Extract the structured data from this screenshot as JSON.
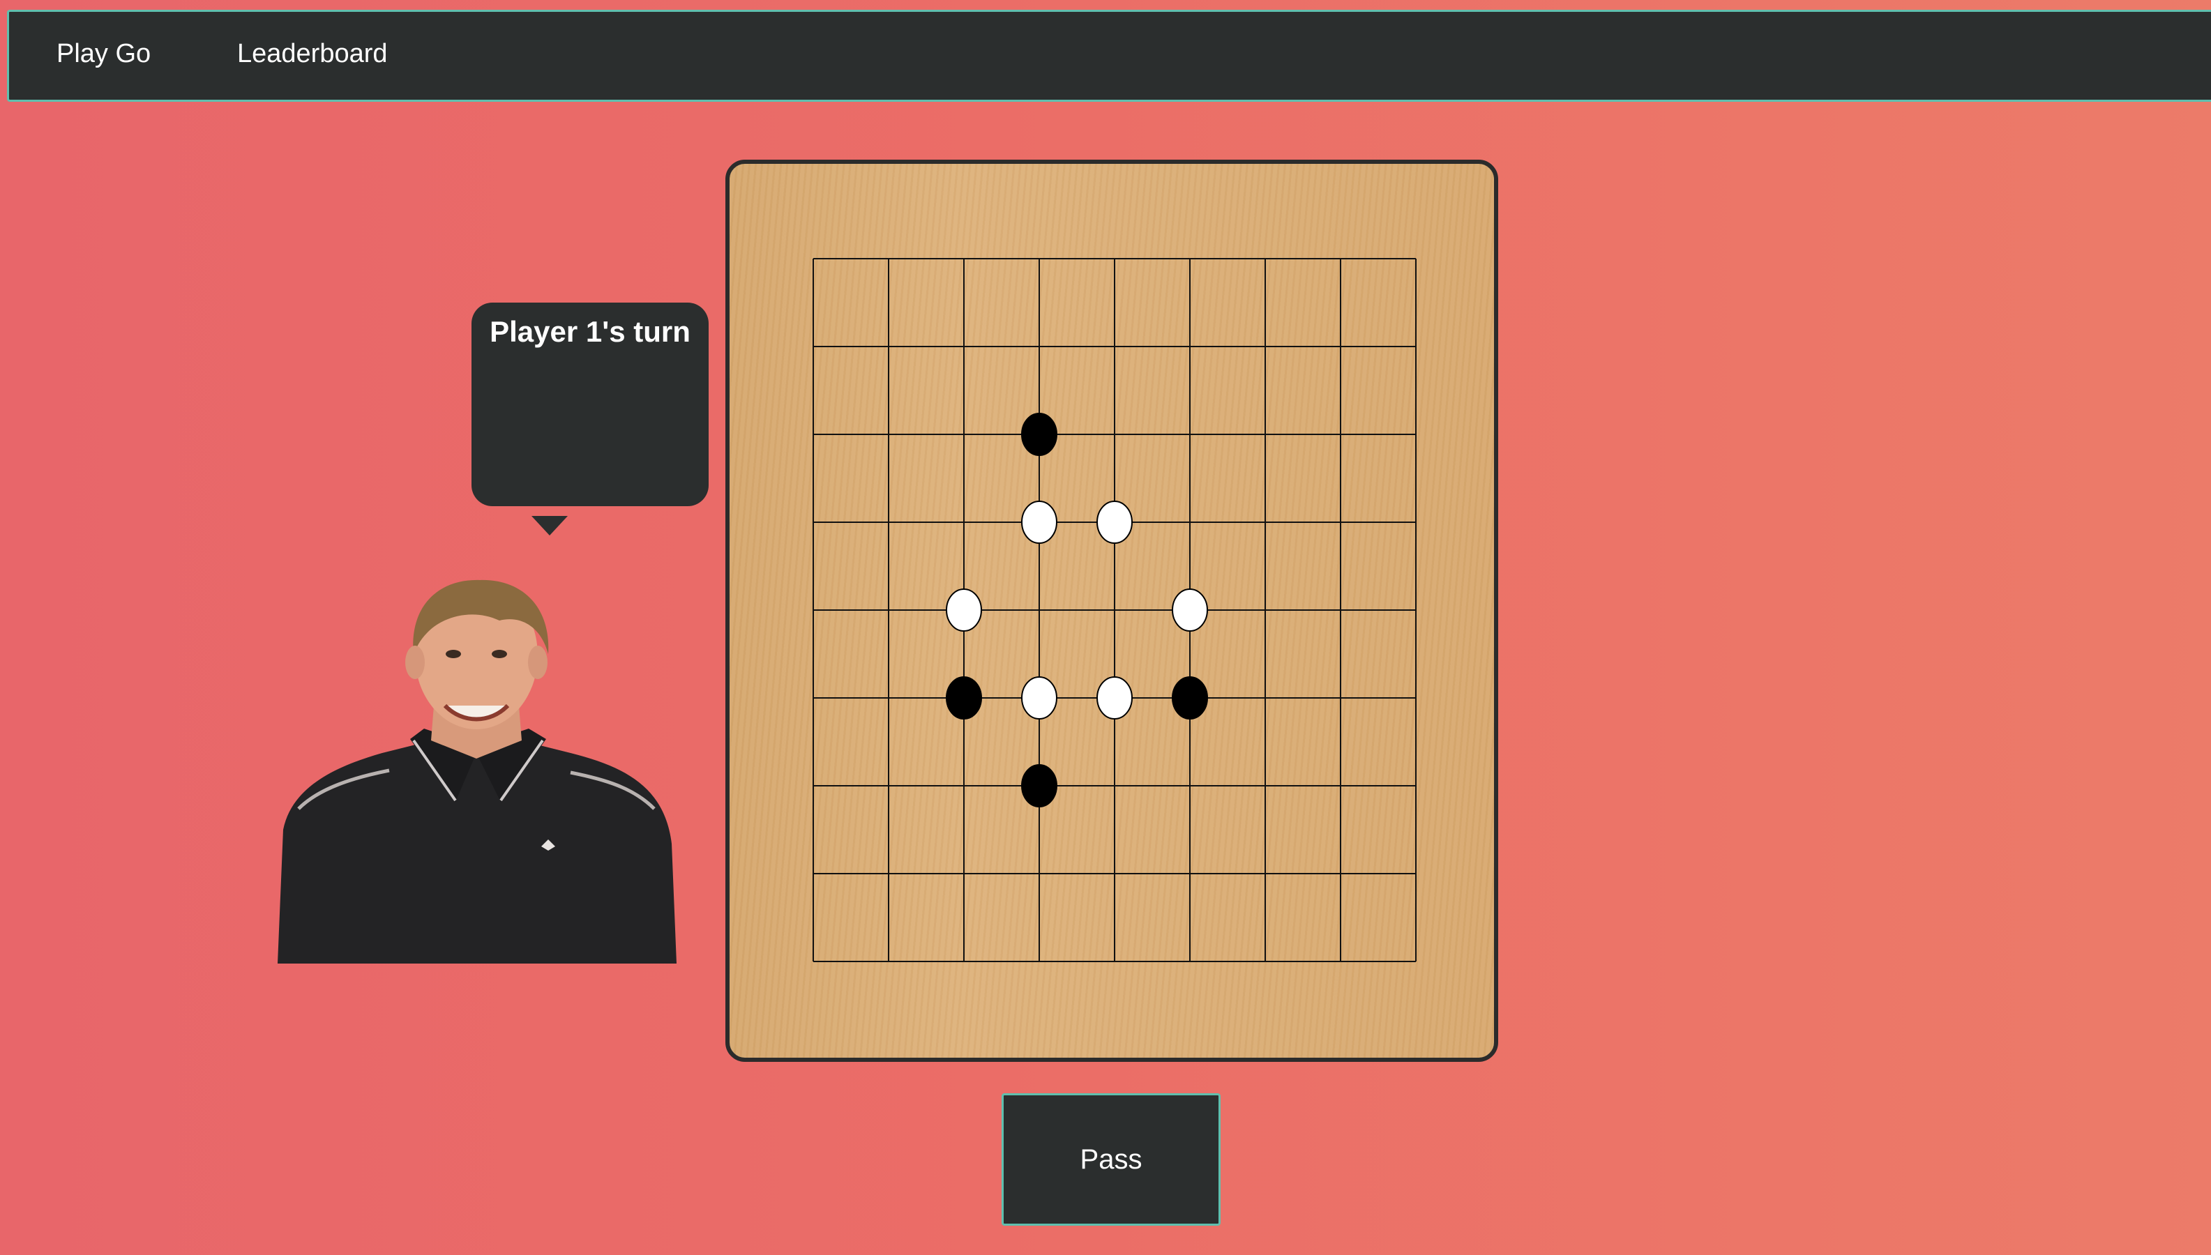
{
  "nav": {
    "items": [
      {
        "label": "Play Go"
      },
      {
        "label": "Leaderboard"
      }
    ]
  },
  "turn_bubble": {
    "text": "Player 1's turn"
  },
  "board": {
    "size": 9,
    "stones": [
      {
        "color": "black",
        "col": 3,
        "row": 2
      },
      {
        "color": "white",
        "col": 3,
        "row": 3
      },
      {
        "color": "white",
        "col": 4,
        "row": 3
      },
      {
        "color": "white",
        "col": 2,
        "row": 4
      },
      {
        "color": "white",
        "col": 5,
        "row": 4
      },
      {
        "color": "black",
        "col": 2,
        "row": 5
      },
      {
        "color": "white",
        "col": 3,
        "row": 5
      },
      {
        "color": "white",
        "col": 4,
        "row": 5
      },
      {
        "color": "black",
        "col": 5,
        "row": 5
      },
      {
        "color": "black",
        "col": 3,
        "row": 6
      }
    ]
  },
  "actions": {
    "pass_label": "Pass"
  },
  "colors": {
    "navbar": "#2b2e2e",
    "accent_border": "#5fbfae",
    "background_left": "#e8666a",
    "background_right": "#ec7b69",
    "board_wood": "#dbae76"
  }
}
